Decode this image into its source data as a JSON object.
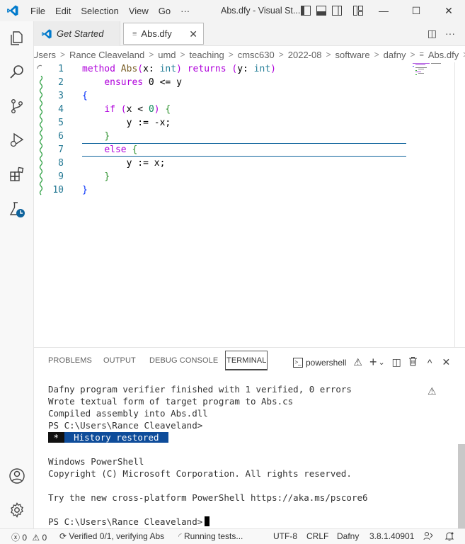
{
  "menu": {
    "file": "File",
    "edit": "Edit",
    "selection": "Selection",
    "view": "View",
    "go": "Go",
    "more": "···"
  },
  "window": {
    "title": "Abs.dfy - Visual St...",
    "minimize": "—",
    "maximize": "☐",
    "close": "✕"
  },
  "tabs": [
    {
      "label": "Get Started"
    },
    {
      "label": "Abs.dfy",
      "close": "✕"
    }
  ],
  "tab_actions": {
    "split": "◫",
    "more": "···"
  },
  "breadcrumb": [
    "Users",
    "Rance Cleaveland",
    "umd",
    "teaching",
    "cmsc630",
    "2022-08",
    "software",
    "dafny",
    "Abs.dfy"
  ],
  "editor": {
    "line_numbers": [
      "1",
      "2",
      "3",
      "4",
      "5",
      "6",
      "7",
      "8",
      "9",
      "10"
    ],
    "lines": {
      "l1_kw": "method",
      "l1_fn": "Abs",
      "l1_p1": "(",
      "l1_arg": "x: ",
      "l1_ty": "int",
      "l1_p2": ")",
      "l1_ret": " returns ",
      "l1_p3": "(",
      "l1_arg2": "y: ",
      "l1_ty2": "int",
      "l1_p4": ")",
      "l2_kw": "ensures",
      "l2_rest": " 0 <= y",
      "l3": "{",
      "l4_kw": "if",
      "l4_open": " (",
      "l4_cond": "x < ",
      "l4_num": "0",
      "l4_close": ")",
      "l4_br": " {",
      "l5": "y := -x;",
      "l6": "}",
      "l7_kw": "else",
      "l7_br": " {",
      "l8": "y := x;",
      "l9": "}",
      "l10": "}"
    }
  },
  "panel": {
    "tabs": [
      "PROBLEMS",
      "OUTPUT",
      "DEBUG CONSOLE",
      "TERMINAL"
    ],
    "shell": "powershell",
    "actions": {
      "warn": "⚠",
      "add": "+",
      "dropdown": "⌄",
      "split": "◫",
      "trash": "🗑",
      "maximize": "^",
      "close": "✕"
    }
  },
  "terminal": {
    "lines": [
      "Dafny program verifier finished with 1 verified, 0 errors",
      "Wrote textual form of target program to Abs.cs",
      "Compiled assembly into Abs.dll",
      "PS C:\\Users\\Rance Cleaveland>"
    ],
    "history_star": " * ",
    "history": " History restored ",
    "ps_header": "Windows PowerShell",
    "copyright": "Copyright (C) Microsoft Corporation. All rights reserved.",
    "try": "Try the new cross-platform PowerShell https://aka.ms/pscore6",
    "prompt": "PS C:\\Users\\Rance Cleaveland>",
    "warn": "⚠"
  },
  "status": {
    "errors": "0",
    "warnings": "0",
    "verified": "Verified 0/1, verifying Abs",
    "running": "Running tests...",
    "encoding": "UTF-8",
    "eol": "CRLF",
    "language": "Dafny",
    "version": "3.8.1.40901"
  },
  "colors": {
    "accent": "#0e639c",
    "history_bg": "#0e4c9a",
    "link_blue": "#007acc"
  }
}
